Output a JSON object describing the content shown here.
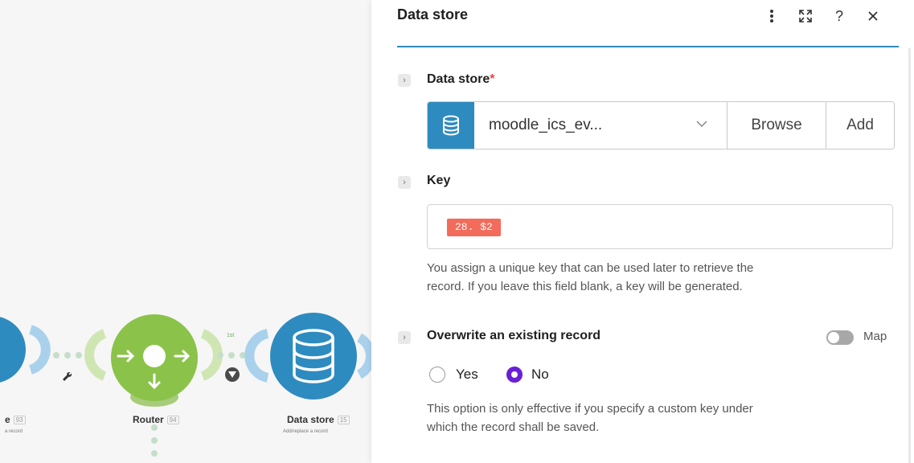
{
  "canvas": {
    "modules": [
      {
        "name": "e",
        "badge": "93",
        "sub": "a record"
      },
      {
        "name": "Router",
        "badge": "94"
      },
      {
        "name": "Data store",
        "badge": "15",
        "sub": "Add/replace a record"
      }
    ],
    "route_label": "1st"
  },
  "panel": {
    "title": "Data store",
    "fields": {
      "data_store": {
        "label": "Data store",
        "required_mark": "*",
        "value": "moodle_ics_ev...",
        "browse_label": "Browse",
        "add_label": "Add"
      },
      "key": {
        "label": "Key",
        "pill": "28. $2",
        "help_line1": "You assign a unique key that can be used later to retrieve the",
        "help_line2": "record. If you leave this field blank, a key will be generated."
      },
      "overwrite": {
        "label": "Overwrite an existing record",
        "map_label": "Map",
        "map_enabled": false,
        "option_yes": "Yes",
        "option_no": "No",
        "selected": "No",
        "help_line1": "This option is only effective if you specify a custom key under",
        "help_line2": "which the record shall be saved."
      }
    }
  },
  "colors": {
    "accent": "#2e8bc0",
    "router_green": "#8bc34a",
    "pill": "#f36b5b",
    "radio_selected": "#6a1fd6",
    "required": "#e8454e"
  },
  "icons": {
    "more": "more-vertical-icon",
    "expand": "expand-icon",
    "help": "help-icon",
    "close": "close-icon",
    "database": "database-icon",
    "chevron": "chevron-right-icon",
    "caret": "chevron-down-icon",
    "wrench": "wrench-icon",
    "filter": "filter-icon"
  }
}
